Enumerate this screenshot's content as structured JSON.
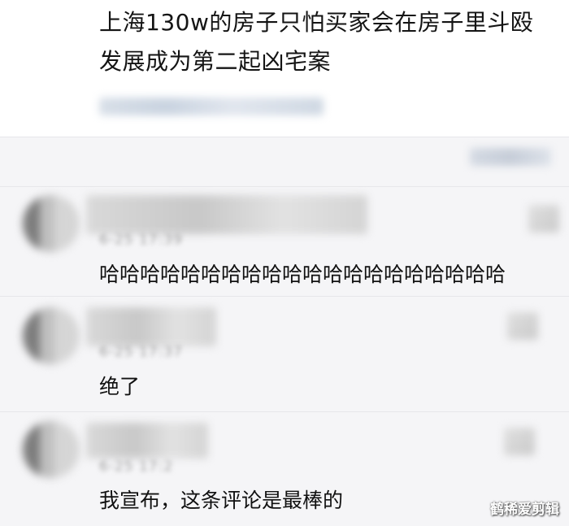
{
  "post": {
    "title": "上海130w的房子只怕买家会在房子里斗殴发展成为第二起凶宅案",
    "meta": "██████████"
  },
  "sort_toggle": "█████",
  "comments": [
    {
      "username": "██████████",
      "timestamp": "6-25 17:39",
      "text": "哈哈哈哈哈哈哈哈哈哈哈哈哈哈哈哈哈哈哈哈"
    },
    {
      "username": "██████",
      "timestamp": "6-25 17:37",
      "text": "绝了"
    },
    {
      "username": "███████",
      "timestamp": "6-25 17:2",
      "text": "我宣布，这条评论是最棒的"
    }
  ],
  "watermark": "鹤稀爱剪辑"
}
